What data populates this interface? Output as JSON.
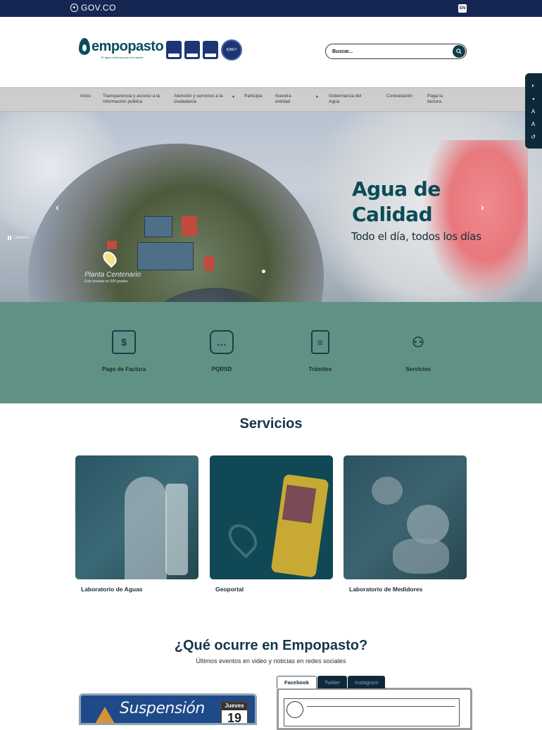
{
  "gov_bar": {
    "label": "GOV.CO",
    "lang": "EN"
  },
  "brand": {
    "name": "empopasto",
    "tagline": "El agua, la fuerza que nos mueve"
  },
  "search": {
    "placeholder": "Buscar..."
  },
  "nav": [
    {
      "label": "Inicio",
      "has_caret": false
    },
    {
      "label": "Transparencia y acceso a la información pública",
      "has_caret": false
    },
    {
      "label": "Atención y servicios a la ciudadanía",
      "has_caret": true
    },
    {
      "label": "Participa",
      "has_caret": false
    },
    {
      "label": "Nuestra entidad",
      "has_caret": true
    },
    {
      "label": "Gobernanza del Agua",
      "has_caret": false
    },
    {
      "label": "Contratación",
      "has_caret": false
    },
    {
      "label": "Paga tu factura",
      "has_caret": false
    }
  ],
  "hero": {
    "title_line1": "Agua de",
    "title_line2": "Calidad",
    "subtitle": "Todo el día, todos los días",
    "place": "Planta Centenario",
    "place_sub": "Foto tomada en 360 grados",
    "pause_label": "Detener"
  },
  "quick_access": [
    {
      "label": "Pago de Factura",
      "icon": "invoice-icon"
    },
    {
      "label": "PQRSD",
      "icon": "chat-icon"
    },
    {
      "label": "Trámites",
      "icon": "clipboard-icon"
    },
    {
      "label": "Servicios",
      "icon": "user-services-icon"
    }
  ],
  "services": {
    "title": "Servicios",
    "items": [
      {
        "label": "Laboratorio de Aguas"
      },
      {
        "label": "Geoportal"
      },
      {
        "label": "Laboratorio de Medidores"
      }
    ]
  },
  "events": {
    "title": "¿Qué ocurre en Empopasto?",
    "subtitle": "Últimos eventos en video y noticias en redes sociales",
    "sign_text": "Suspensión",
    "sign_day": "Jueves",
    "sign_num": "19",
    "tabs": [
      "Facebook",
      "Twitter",
      "Instagram"
    ]
  },
  "colors": {
    "gov_bar": "#162652",
    "brand": "#0a4d5e",
    "quick_bg": "#5f9285",
    "nav_bg": "#cdcdcd"
  }
}
